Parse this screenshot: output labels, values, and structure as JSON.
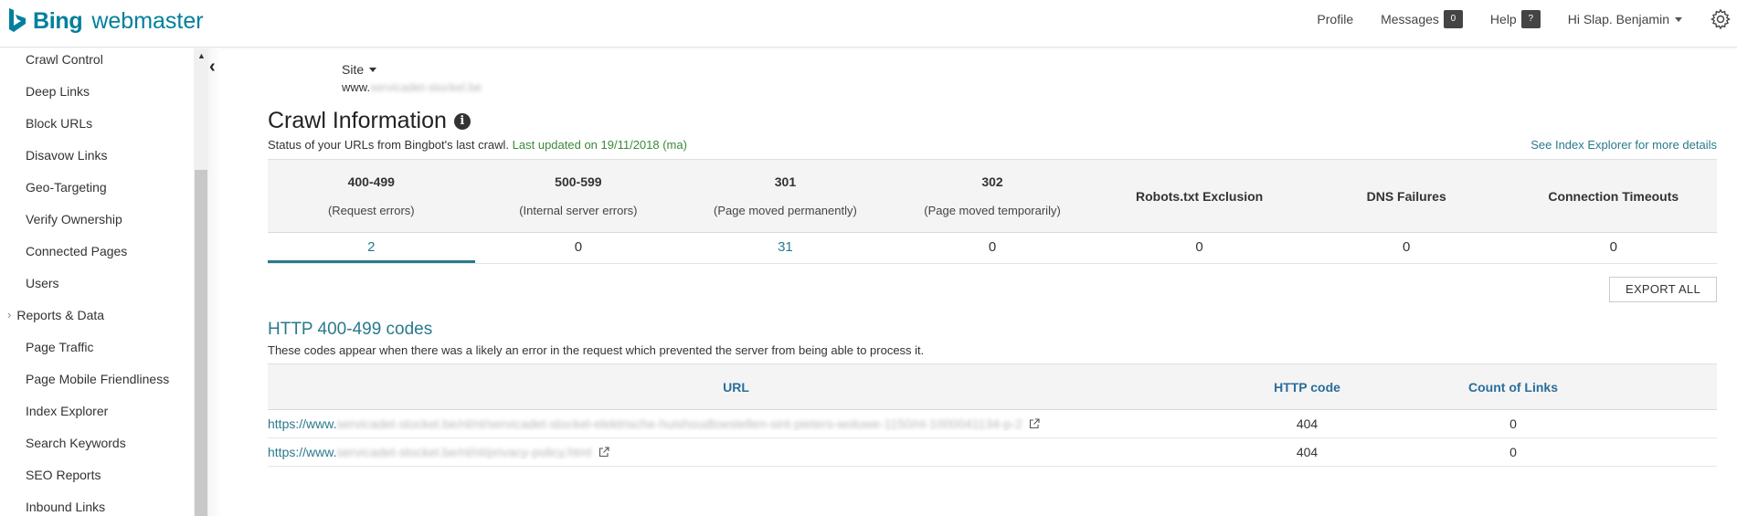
{
  "header": {
    "brand": "Bing",
    "product": "webmaster",
    "nav": {
      "profile": "Profile",
      "messages": "Messages",
      "messages_count": "0",
      "help": "Help",
      "help_badge": "?",
      "user": "Hi Slap. Benjamin"
    }
  },
  "sidebar": {
    "items": [
      {
        "label": "Crawl Control",
        "type": "item"
      },
      {
        "label": "Deep Links",
        "type": "item"
      },
      {
        "label": "Block URLs",
        "type": "item"
      },
      {
        "label": "Disavow Links",
        "type": "item"
      },
      {
        "label": "Geo-Targeting",
        "type": "item"
      },
      {
        "label": "Verify Ownership",
        "type": "item"
      },
      {
        "label": "Connected Pages",
        "type": "item"
      },
      {
        "label": "Users",
        "type": "item"
      },
      {
        "label": "Reports & Data",
        "type": "section"
      },
      {
        "label": "Page Traffic",
        "type": "item"
      },
      {
        "label": "Page Mobile Friendliness",
        "type": "item"
      },
      {
        "label": "Index Explorer",
        "type": "item"
      },
      {
        "label": "Search Keywords",
        "type": "item"
      },
      {
        "label": "SEO Reports",
        "type": "item"
      },
      {
        "label": "Inbound Links",
        "type": "item"
      }
    ]
  },
  "site": {
    "label": "Site",
    "url_prefix": "www.",
    "url_blurred": "servicadet-stockel.be"
  },
  "page": {
    "title": "Crawl Information",
    "status_text": "Status of your URLs from Bingbot's last crawl.",
    "updated_text": "Last updated on 19/11/2018 (ma)",
    "index_link": "See Index Explorer for more details"
  },
  "summary": {
    "columns": [
      {
        "code": "400-499",
        "desc": "(Request errors)",
        "value": "2",
        "link": true,
        "active": true
      },
      {
        "code": "500-599",
        "desc": "(Internal server errors)",
        "value": "0",
        "link": false,
        "active": false
      },
      {
        "code": "301",
        "desc": "(Page moved permanently)",
        "value": "31",
        "link": true,
        "active": false
      },
      {
        "code": "302",
        "desc": "(Page moved temporarily)",
        "value": "0",
        "link": false,
        "active": false
      },
      {
        "code": "Robots.txt Exclusion",
        "desc": "",
        "value": "0",
        "link": false,
        "active": false
      },
      {
        "code": "DNS Failures",
        "desc": "",
        "value": "0",
        "link": false,
        "active": false
      },
      {
        "code": "Connection Timeouts",
        "desc": "",
        "value": "0",
        "link": false,
        "active": false
      }
    ]
  },
  "export": {
    "label": "EXPORT ALL"
  },
  "codes": {
    "title": "HTTP 400-499 codes",
    "description": "These codes appear when there was a likely an error in the request which prevented the server from being able to process it.",
    "headers": {
      "url": "URL",
      "code": "HTTP code",
      "count": "Count of Links"
    },
    "rows": [
      {
        "url_prefix": "https://www.",
        "url_blurred": "servicadet-stockel.be/nl/nl/servicadet-stockel-elektrische-huishoudtoestellen-sint-pieters-woluwe-1150/nl-1000041134-p-2",
        "code": "404",
        "count": "0"
      },
      {
        "url_prefix": "https://www.",
        "url_blurred": "servicadet-stockel.be/nl/nl/privacy-policy.html",
        "code": "404",
        "count": "0"
      }
    ]
  },
  "colors": {
    "accent": "#2a7a8c",
    "brand": "#00809d",
    "updated": "#3a8a3a"
  }
}
